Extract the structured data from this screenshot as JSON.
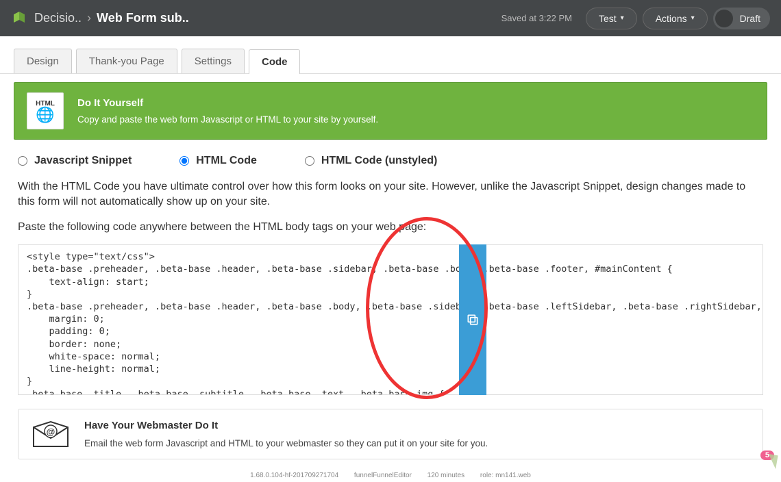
{
  "topbar": {
    "breadcrumb_parent": "Decisio..",
    "breadcrumb_current": "Web Form sub..",
    "saved_label": "Saved at 3:22 PM",
    "test_label": "Test",
    "actions_label": "Actions",
    "draft_label": "Draft"
  },
  "tabs": [
    {
      "label": "Design",
      "active": false
    },
    {
      "label": "Thank-you Page",
      "active": false
    },
    {
      "label": "Settings",
      "active": false
    },
    {
      "label": "Code",
      "active": true
    }
  ],
  "banner": {
    "icon_label": "HTML",
    "title": "Do It Yourself",
    "subtitle": "Copy and paste the web form Javascript or HTML to your site by yourself."
  },
  "radio_options": [
    {
      "label": "Javascript Snippet",
      "checked": false
    },
    {
      "label": "HTML Code",
      "checked": true
    },
    {
      "label": "HTML Code (unstyled)",
      "checked": false
    }
  ],
  "description": {
    "p1": "With the HTML Code you have ultimate control over how this form looks on your site. However, unlike the Javascript Snippet, design changes made to this form will not automatically show up on your site.",
    "p2": "Paste the following code anywhere between the HTML body tags on your web page:"
  },
  "code_snippet": "<style type=\"text/css\">\n.beta-base .preheader, .beta-base .header, .beta-base .sidebar, .beta-base .body, .beta-base .footer, #mainContent {\n    text-align: start;\n}\n.beta-base .preheader, .beta-base .header, .beta-base .body, .beta-base .sidebar, .beta-base .leftSidebar, .beta-base .rightSidebar, .beta-base .footer {\n    margin: 0;\n    padding: 0;\n    border: none;\n    white-space: normal;\n    line-height: normal;\n}\n.beta-base .title, .beta-base .subtitle, .beta-base .text, .beta-base img {",
  "webmaster": {
    "title": "Have Your Webmaster Do It",
    "subtitle": "Email the web form Javascript and HTML to your webmaster so they can put it on your site for you."
  },
  "footer": {
    "version": "1.68.0.104-hf-201709271704",
    "module": "funnelFunnelEditor",
    "time": "120 minutes",
    "role": "role: mn141.web"
  },
  "badge_count": "5"
}
